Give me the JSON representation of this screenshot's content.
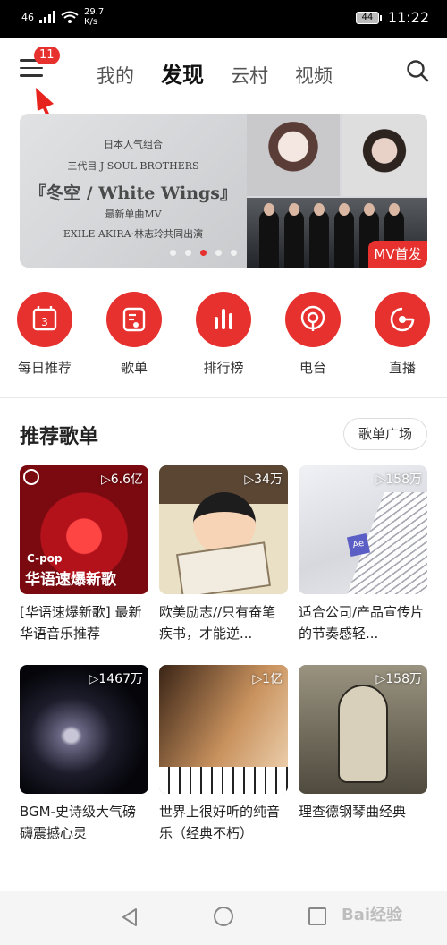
{
  "status_bar": {
    "signal": "46",
    "speed_value": "29.7",
    "speed_unit": "K/s",
    "battery": "44",
    "time": "11:22"
  },
  "top_nav": {
    "badge_count": "11",
    "tabs": [
      {
        "label": "我的",
        "active": false
      },
      {
        "label": "发现",
        "active": true
      },
      {
        "label": "云村",
        "active": false
      },
      {
        "label": "视频",
        "active": false
      }
    ]
  },
  "banner": {
    "line1": "日本人气组合",
    "line2": "三代目 J SOUL BROTHERS",
    "line3": "『冬空 / White Wings』",
    "line4": "最新单曲MV",
    "line5": "EXILE AKIRA·林志玲共同出演",
    "tag": "MV首发",
    "active_dot": 3
  },
  "shortcuts": [
    {
      "label": "每日推荐",
      "icon": "calendar-icon",
      "extra": "3"
    },
    {
      "label": "歌单",
      "icon": "playlist-icon"
    },
    {
      "label": "排行榜",
      "icon": "chart-bars-icon"
    },
    {
      "label": "电台",
      "icon": "radio-icon"
    },
    {
      "label": "直播",
      "icon": "live-icon"
    }
  ],
  "section": {
    "title": "推荐歌单",
    "more_button": "歌单广场"
  },
  "playlists": [
    {
      "count": "▷6.6亿",
      "title": "[华语速爆新歌] 最新华语音乐推荐",
      "cover_text_small": "C-pop",
      "cover_text_big": "华语速爆新歌"
    },
    {
      "count": "▷34万",
      "title": "欧美励志//只有奋笔疾书，才能逆..."
    },
    {
      "count": "▷158万",
      "title": "适合公司/产品宣传片的节奏感轻...",
      "cover_text_small": "Ae"
    },
    {
      "count": "▷1467万",
      "title": "BGM-史诗级大气磅礴震撼心灵"
    },
    {
      "count": "▷1亿",
      "title": "世界上很好听的纯音乐（经典不朽）"
    },
    {
      "count": "▷158万",
      "title": "理查德钢琴曲经典"
    }
  ],
  "watermark": "Bai经验",
  "colors": {
    "accent": "#e6312f",
    "text": "#222222",
    "navbar": "#f5f5f5"
  }
}
